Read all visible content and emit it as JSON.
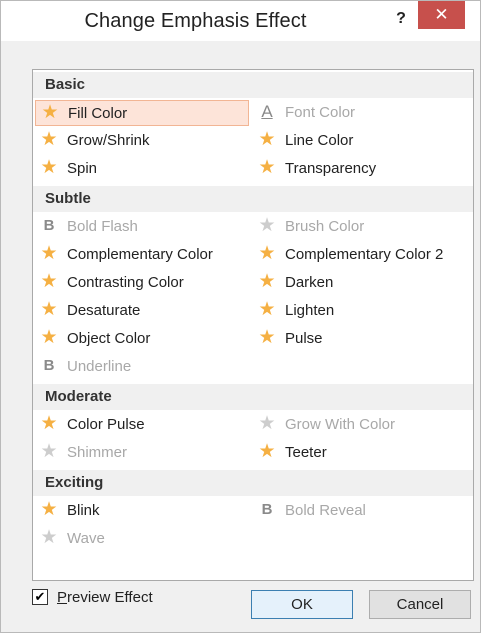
{
  "window": {
    "title": "Change Emphasis Effect",
    "help_label": "?",
    "close_label": "✕",
    "close_color": "#c7504c"
  },
  "sections": [
    {
      "label": "Basic",
      "items": [
        {
          "label": "Fill Color",
          "icon": "star-icon",
          "disabled": false,
          "selected": true
        },
        {
          "label": "Font Color",
          "icon": "font-color-icon",
          "disabled": true,
          "selected": false
        },
        {
          "label": "Grow/Shrink",
          "icon": "star-icon",
          "disabled": false,
          "selected": false
        },
        {
          "label": "Line Color",
          "icon": "star-icon",
          "disabled": false,
          "selected": false
        },
        {
          "label": "Spin",
          "icon": "star-icon",
          "disabled": false,
          "selected": false
        },
        {
          "label": "Transparency",
          "icon": "star-icon",
          "disabled": false,
          "selected": false
        }
      ]
    },
    {
      "label": "Subtle",
      "items": [
        {
          "label": "Bold Flash",
          "icon": "bold-icon",
          "disabled": true,
          "selected": false
        },
        {
          "label": "Brush Color",
          "icon": "star-icon",
          "disabled": true,
          "selected": false
        },
        {
          "label": "Complementary Color",
          "icon": "star-icon",
          "disabled": false,
          "selected": false
        },
        {
          "label": "Complementary Color 2",
          "icon": "star-icon",
          "disabled": false,
          "selected": false
        },
        {
          "label": "Contrasting Color",
          "icon": "star-icon",
          "disabled": false,
          "selected": false
        },
        {
          "label": "Darken",
          "icon": "star-icon",
          "disabled": false,
          "selected": false
        },
        {
          "label": "Desaturate",
          "icon": "star-icon",
          "disabled": false,
          "selected": false
        },
        {
          "label": "Lighten",
          "icon": "star-icon",
          "disabled": false,
          "selected": false
        },
        {
          "label": "Object Color",
          "icon": "star-icon",
          "disabled": false,
          "selected": false
        },
        {
          "label": "Pulse",
          "icon": "star-icon",
          "disabled": false,
          "selected": false
        },
        {
          "label": "Underline",
          "icon": "bold-icon",
          "disabled": true,
          "selected": false
        }
      ]
    },
    {
      "label": "Moderate",
      "items": [
        {
          "label": "Color Pulse",
          "icon": "star-icon",
          "disabled": false,
          "selected": false
        },
        {
          "label": "Grow With Color",
          "icon": "star-icon",
          "disabled": true,
          "selected": false
        },
        {
          "label": "Shimmer",
          "icon": "star-icon",
          "disabled": true,
          "selected": false
        },
        {
          "label": "Teeter",
          "icon": "star-icon",
          "disabled": false,
          "selected": false
        }
      ]
    },
    {
      "label": "Exciting",
      "items": [
        {
          "label": "Blink",
          "icon": "star-icon",
          "disabled": false,
          "selected": false
        },
        {
          "label": "Bold Reveal",
          "icon": "bold-icon",
          "disabled": true,
          "selected": false
        },
        {
          "label": "Wave",
          "icon": "star-icon",
          "disabled": true,
          "selected": false
        }
      ]
    }
  ],
  "footer": {
    "preview_label": "Preview Effect",
    "preview_checked": true,
    "ok_label": "OK",
    "cancel_label": "Cancel"
  },
  "colors": {
    "star_enabled": "#f5b043",
    "star_disabled": "#cdcdcd",
    "selection_bg": "#fde4d9",
    "selection_border": "#f2b594"
  }
}
